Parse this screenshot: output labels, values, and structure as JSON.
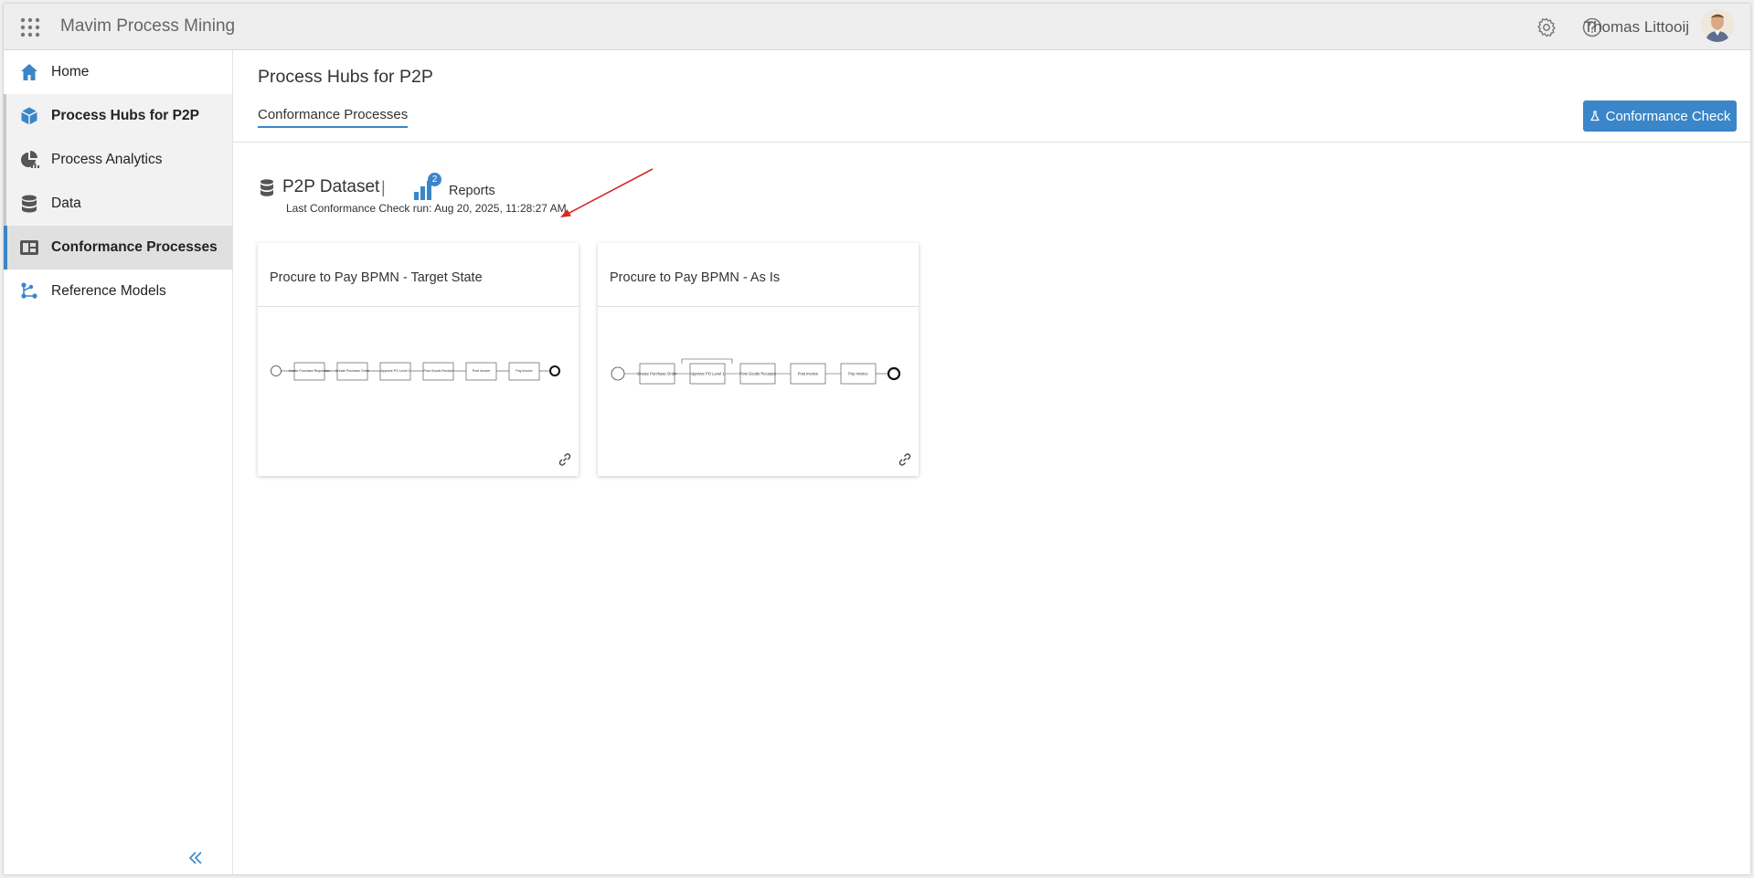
{
  "app": {
    "title": "Mavim Process Mining"
  },
  "header": {
    "user_name": "Thomas Littooij"
  },
  "sidebar": {
    "items": [
      {
        "label": "Home",
        "icon": "home-icon"
      },
      {
        "label": "Process Hubs for P2P",
        "icon": "cube-icon"
      },
      {
        "label": "Process Analytics",
        "icon": "pie-chart-icon"
      },
      {
        "label": "Data",
        "icon": "database-icon"
      },
      {
        "label": "Conformance Processes",
        "icon": "conformance-icon"
      },
      {
        "label": "Reference Models",
        "icon": "model-icon"
      }
    ]
  },
  "page": {
    "title": "Process Hubs for P2P",
    "tab": "Conformance Processes",
    "action_button": "Conformance Check"
  },
  "dataset": {
    "name": "P2P Dataset",
    "separator": "|",
    "reports_count": "2",
    "reports_label": "Reports",
    "last_run": "Last Conformance Check run: Aug 20, 2025, 11:28:27 AM"
  },
  "cards": [
    {
      "title": "Procure to Pay BPMN - Target State",
      "tasks": [
        "Create Purchase Requisition",
        "Create Purchase Order",
        "Approve PO Level 1",
        "Post Goods Receipt",
        "Post invoice",
        "Pay invoice"
      ]
    },
    {
      "title": "Procure to Pay BPMN - As Is",
      "tasks": [
        "Create Purchase Order",
        "Approve PO Level 1",
        "Post Goods Receipts",
        "Post invoice",
        "Pay invoice"
      ]
    }
  ],
  "colors": {
    "accent": "#3a86c8",
    "annotation": "#d62828"
  }
}
